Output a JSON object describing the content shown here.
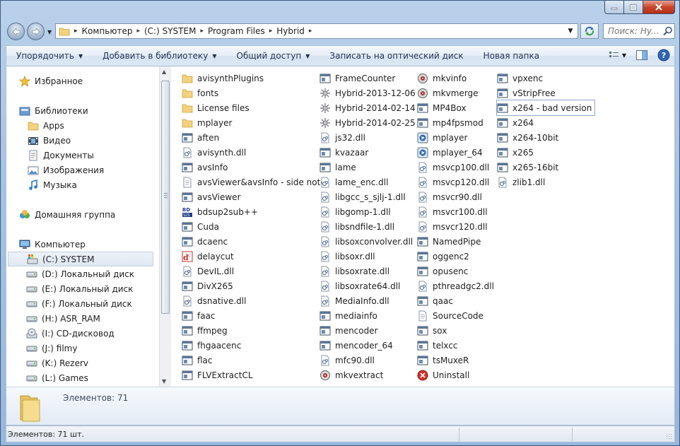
{
  "window": {
    "caption": {
      "min_icon": "minimize-icon",
      "max_icon": "maximize-icon",
      "close_icon": "close-icon"
    }
  },
  "address": {
    "crumbs": [
      "Компьютер",
      "(C:) SYSTEM",
      "Program Files",
      "Hybrid"
    ],
    "search_placeholder": "Поиск: Hy..."
  },
  "toolbar": {
    "organize": "Упорядочить",
    "add_library": "Добавить в библиотеку",
    "share": "Общий доступ",
    "burn": "Записать на оптический диск",
    "new_folder": "Новая папка"
  },
  "nav": {
    "favorites": "Избранное",
    "libraries": "Библиотеки",
    "library_items": [
      "Apps",
      "Видео",
      "Документы",
      "Изображения",
      "Музыка"
    ],
    "homegroup": "Домашняя группа",
    "computer": "Компьютер",
    "drives": [
      {
        "label": "(C:) SYSTEM",
        "icon": "system-drive-icon"
      },
      {
        "label": "(D:) Локальный диск",
        "icon": "drive-icon"
      },
      {
        "label": "(E:) Локальный диск",
        "icon": "drive-icon"
      },
      {
        "label": "(F:) Локальный диск",
        "icon": "drive-icon"
      },
      {
        "label": "(H:) ASR_RAM",
        "icon": "drive-icon"
      },
      {
        "label": "(I:) CD-дисковод",
        "icon": "cd-drive-icon"
      },
      {
        "label": "(J:) filmy",
        "icon": "drive-icon"
      },
      {
        "label": "(K:) Rezerv",
        "icon": "drive-icon"
      },
      {
        "label": "(L:) Games",
        "icon": "drive-icon"
      }
    ]
  },
  "files": {
    "col1": [
      {
        "name": "avisynthPlugins",
        "icon": "folder-icon"
      },
      {
        "name": "fonts",
        "icon": "folder-icon"
      },
      {
        "name": "License files",
        "icon": "folder-icon"
      },
      {
        "name": "mplayer",
        "icon": "folder-icon"
      },
      {
        "name": "aften",
        "icon": "app-icon"
      },
      {
        "name": "avisynth.dll",
        "icon": "dll-icon"
      },
      {
        "name": "avsInfo",
        "icon": "app-icon"
      },
      {
        "name": "avsViewer&avsInfo - side note",
        "icon": "text-file-icon"
      },
      {
        "name": "avsViewer",
        "icon": "app-icon"
      },
      {
        "name": "bdsup2sub++",
        "icon": "bdsup-icon"
      },
      {
        "name": "Cuda",
        "icon": "app-icon"
      },
      {
        "name": "dcaenc",
        "icon": "app-icon"
      },
      {
        "name": "delaycut",
        "icon": "delaycut-icon"
      },
      {
        "name": "DevIL.dll",
        "icon": "dll-icon"
      },
      {
        "name": "DivX265",
        "icon": "app-icon"
      },
      {
        "name": "dsnative.dll",
        "icon": "dll-icon"
      },
      {
        "name": "faac",
        "icon": "app-icon"
      },
      {
        "name": "ffmpeg",
        "icon": "app-icon"
      },
      {
        "name": "fhgaacenc",
        "icon": "app-icon"
      },
      {
        "name": "flac",
        "icon": "app-icon"
      },
      {
        "name": "FLVExtractCL",
        "icon": "app-icon"
      }
    ],
    "col2": [
      {
        "name": "FrameCounter",
        "icon": "app-icon"
      },
      {
        "name": "Hybrid-2013-12-06",
        "icon": "hybrid-icon"
      },
      {
        "name": "Hybrid-2014-02-14",
        "icon": "hybrid-icon"
      },
      {
        "name": "Hybrid-2014-02-25",
        "icon": "hybrid-icon"
      },
      {
        "name": "js32.dll",
        "icon": "dll-icon"
      },
      {
        "name": "kvazaar",
        "icon": "app-icon"
      },
      {
        "name": "lame",
        "icon": "app-icon"
      },
      {
        "name": "lame_enc.dll",
        "icon": "dll-icon"
      },
      {
        "name": "libgcc_s_sjlj-1.dll",
        "icon": "dll-icon"
      },
      {
        "name": "libgomp-1.dll",
        "icon": "dll-icon"
      },
      {
        "name": "libsndfile-1.dll",
        "icon": "dll-icon"
      },
      {
        "name": "libsoxconvolver.dll",
        "icon": "dll-icon"
      },
      {
        "name": "libsoxr.dll",
        "icon": "dll-icon"
      },
      {
        "name": "libsoxrate.dll",
        "icon": "dll-icon"
      },
      {
        "name": "libsoxrate64.dll",
        "icon": "dll-icon"
      },
      {
        "name": "MediaInfo.dll",
        "icon": "dll-icon"
      },
      {
        "name": "mediainfo",
        "icon": "app-icon"
      },
      {
        "name": "mencoder",
        "icon": "app-icon"
      },
      {
        "name": "mencoder_64",
        "icon": "app-icon"
      },
      {
        "name": "mfc90.dll",
        "icon": "dll-icon"
      },
      {
        "name": "mkvextract",
        "icon": "mkv-icon"
      }
    ],
    "col3": [
      {
        "name": "mkvinfo",
        "icon": "mkv-icon"
      },
      {
        "name": "mkvmerge",
        "icon": "mkv-icon"
      },
      {
        "name": "MP4Box",
        "icon": "app-icon"
      },
      {
        "name": "mp4fpsmod",
        "icon": "app-icon"
      },
      {
        "name": "mplayer",
        "icon": "mplayer-icon"
      },
      {
        "name": "mplayer_64",
        "icon": "mplayer-icon"
      },
      {
        "name": "msvcp100.dll",
        "icon": "dll-icon"
      },
      {
        "name": "msvcp120.dll",
        "icon": "dll-icon"
      },
      {
        "name": "msvcr90.dll",
        "icon": "dll-icon"
      },
      {
        "name": "msvcr100.dll",
        "icon": "dll-icon"
      },
      {
        "name": "msvcr120.dll",
        "icon": "dll-icon"
      },
      {
        "name": "NamedPipe",
        "icon": "app-icon"
      },
      {
        "name": "oggenc2",
        "icon": "app-icon"
      },
      {
        "name": "opusenc",
        "icon": "app-icon"
      },
      {
        "name": "pthreadgc2.dll",
        "icon": "dll-icon"
      },
      {
        "name": "qaac",
        "icon": "app-icon"
      },
      {
        "name": "SourceCode",
        "icon": "text-file-icon"
      },
      {
        "name": "sox",
        "icon": "app-icon"
      },
      {
        "name": "telxcc",
        "icon": "app-icon"
      },
      {
        "name": "tsMuxeR",
        "icon": "app-icon"
      },
      {
        "name": "Uninstall",
        "icon": "uninstall-icon"
      }
    ],
    "col4": [
      {
        "name": "vpxenc",
        "icon": "app-icon"
      },
      {
        "name": "vStripFree",
        "icon": "app-icon"
      },
      {
        "name": "x264 - bad version",
        "icon": "app-icon",
        "focused": true
      },
      {
        "name": "x264",
        "icon": "app-icon"
      },
      {
        "name": "x264-10bit",
        "icon": "app-icon"
      },
      {
        "name": "x265",
        "icon": "app-icon"
      },
      {
        "name": "x265-16bit",
        "icon": "app-icon"
      },
      {
        "name": "zlib1.dll",
        "icon": "dll-icon"
      }
    ]
  },
  "details": {
    "count": "Элементов: 71"
  },
  "status": {
    "text": "Элементов: 71 шт."
  }
}
